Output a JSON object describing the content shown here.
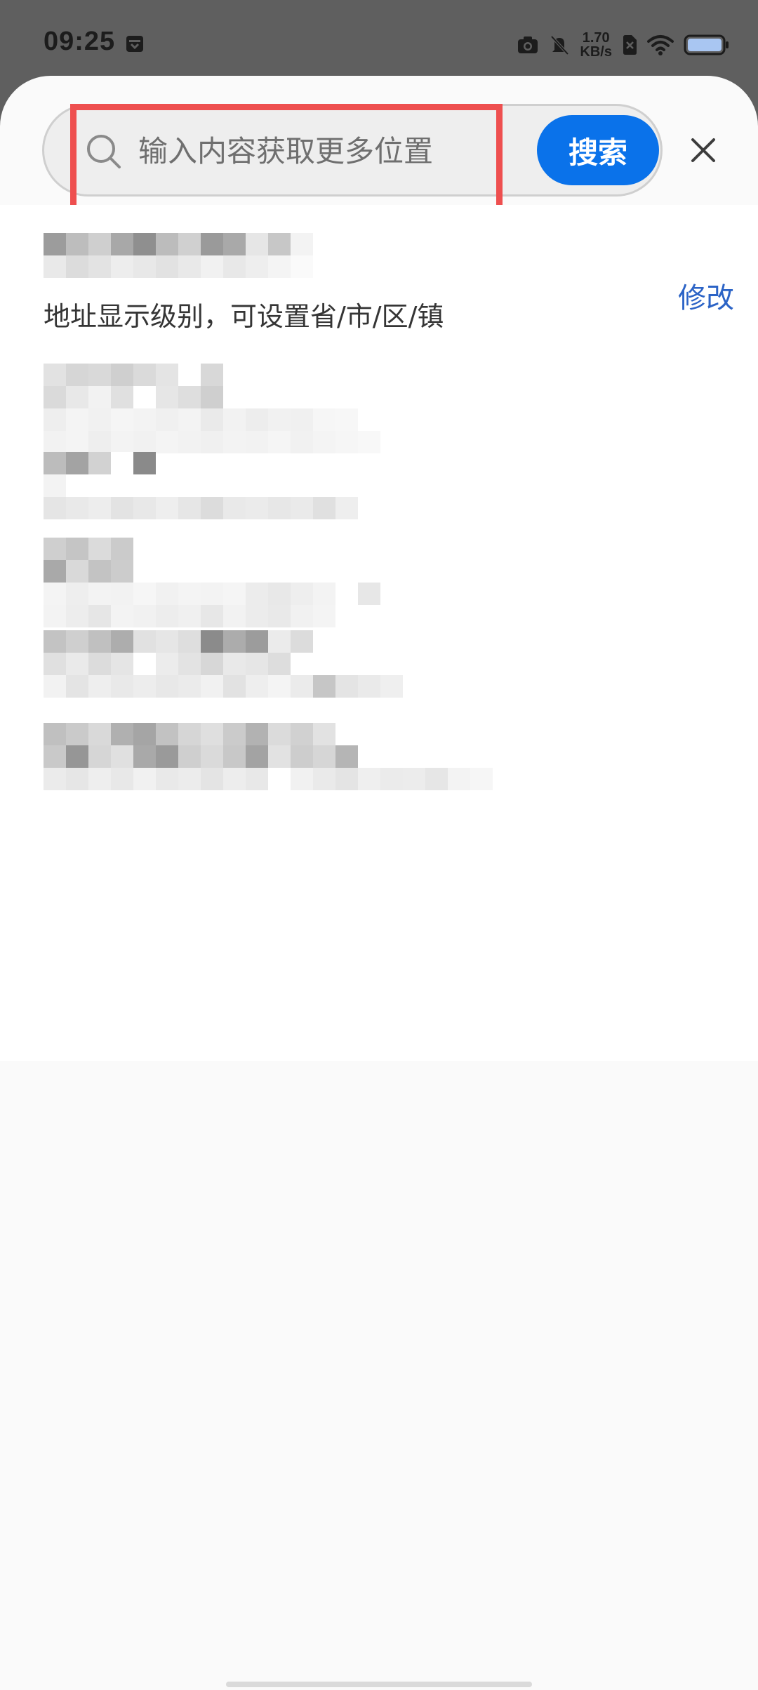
{
  "status_bar": {
    "time": "09:25",
    "net_speed_value": "1.70",
    "net_speed_unit": "KB/s",
    "icons": [
      "calendar-icon",
      "camera-icon",
      "mute-icon",
      "sim-off-icon",
      "wifi-icon",
      "battery-icon"
    ]
  },
  "search": {
    "placeholder": "输入内容获取更多位置",
    "value": "",
    "button_label": "搜索",
    "close_icon": "close-icon"
  },
  "current_location": {
    "hint": "地址显示级别，可设置省/市/区/镇",
    "modify_label": "修改"
  },
  "location_items_count_note": "",
  "colors": {
    "accent": "#0a72ea",
    "link": "#2b63c6",
    "highlight": "#ee4f4f",
    "scrim": "#5f5f5f"
  }
}
